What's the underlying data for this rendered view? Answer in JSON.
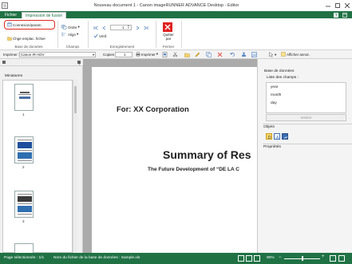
{
  "window": {
    "title": "Nouveau document 1 - Canon imageRUNNER ADVANCE Desktop - Editor"
  },
  "tabs": [
    {
      "label": "Fichier"
    },
    {
      "label": "Impression de fusion"
    }
  ],
  "ribbon": {
    "database_group": {
      "connect_label": "Connexion/param.",
      "change_location_label": "Chge emplac. fichier",
      "group_label": "Base de données"
    },
    "fields_group": {
      "order_label": "Ordre",
      "align_label": "Align",
      "group_label": "Champs"
    },
    "records_group": {
      "record_number": "1",
      "view_label": "Vérif.",
      "group_label": "Enregistrement"
    },
    "close_group": {
      "close_label_line1": "Quitter",
      "close_label_line2": "par",
      "group_label": "Fermer"
    }
  },
  "toolbar": {
    "printer_label": "Imprimer :",
    "printer_value": "Canon iR-ADV",
    "copies_label": "Copies",
    "copies_value": "1",
    "print_label": "Imprimer",
    "show_annotations_label": "Afficher annot."
  },
  "left_pane": {
    "title": "Miniatures",
    "thumbnails": [
      {
        "label": "1"
      },
      {
        "label": "2"
      },
      {
        "label": "3"
      }
    ]
  },
  "document": {
    "for_line": "For: XX Corporation",
    "summary_title": "Summary of Res",
    "future_line": "The Future Development of “DE LA C"
  },
  "right_pane": {
    "database_title": "Base de données",
    "field_list_label": "Liste des champs :",
    "fields": [
      "year",
      "month",
      "day"
    ],
    "insert_label": "Insérer",
    "objects_title": "Objets",
    "properties_title": "Propriétés"
  },
  "status": {
    "page_selected": "Page sélectionnée : 1/1",
    "db_file": "Nom du fichier de la base de données : Sample.xls",
    "zoom": "90%"
  },
  "colors": {
    "accent": "#207245",
    "highlight": "#e0281e",
    "close_button": "#e02020"
  }
}
